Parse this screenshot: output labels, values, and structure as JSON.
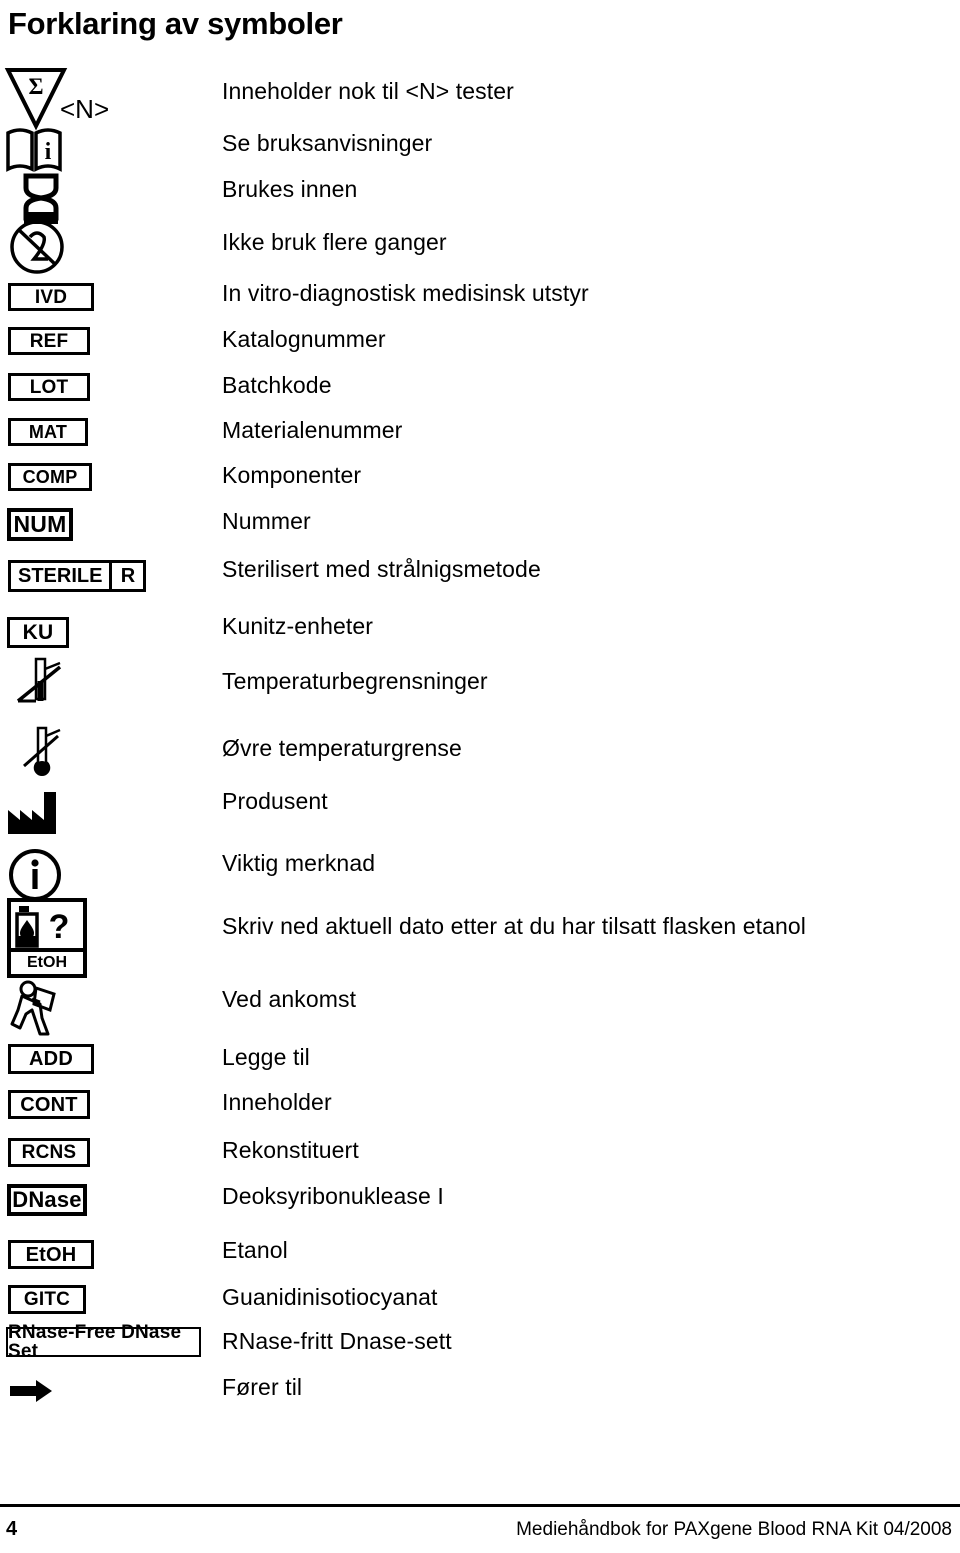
{
  "document": {
    "title": "Forklaring av symboler",
    "n_marker": "<N>"
  },
  "rows": [
    {
      "icon": "sum-triangle-n-icon",
      "label": "Inneholder nok til <N> tester"
    },
    {
      "icon": "consult-instructions-booklet-icon",
      "label": "Se bruksanvisninger"
    },
    {
      "icon": "use-by-hourglass-icon",
      "label": "Brukes innen"
    },
    {
      "icon": "do-not-reuse-icon",
      "label": "Ikke bruk flere ganger"
    },
    {
      "icon": "ivd-box-icon",
      "box_text": "IVD",
      "label": "In vitro-diagnostisk medisinsk utstyr"
    },
    {
      "icon": "ref-box-icon",
      "box_text": "REF",
      "label": "Katalognummer"
    },
    {
      "icon": "lot-box-icon",
      "box_text": "LOT",
      "label": "Batchkode"
    },
    {
      "icon": "mat-box-icon",
      "box_text": "MAT",
      "label": "Materialenummer"
    },
    {
      "icon": "comp-box-icon",
      "box_text": "COMP",
      "label": "Komponenter"
    },
    {
      "icon": "num-box-icon",
      "box_text": "NUM",
      "label": "Nummer"
    },
    {
      "icon": "sterile-r-box-icon",
      "box_text": "STERILE",
      "box_text2": "R",
      "label": "Sterilisert med strålnigsmetode"
    },
    {
      "icon": "ku-box-icon",
      "box_text": "KU",
      "label": "Kunitz-enheter"
    },
    {
      "icon": "temperature-limits-icon",
      "label": "Temperaturbegrensninger"
    },
    {
      "icon": "upper-temperature-limit-icon",
      "label": "Øvre temperaturgrense"
    },
    {
      "icon": "manufacturer-factory-icon",
      "label": "Produsent"
    },
    {
      "icon": "important-note-info-icon",
      "label": "Viktig merknad"
    },
    {
      "icon": "etoh-bottle-question-icon",
      "box_text": "EtOH",
      "label": "Skriv ned aktuell dato etter at du har tilsatt flasken etanol"
    },
    {
      "icon": "on-arrival-person-icon",
      "label": "Ved ankomst"
    },
    {
      "icon": "add-box-icon",
      "box_text": "ADD",
      "label": "Legge til"
    },
    {
      "icon": "cont-box-icon",
      "box_text": "CONT",
      "label": "Inneholder"
    },
    {
      "icon": "rcns-box-icon",
      "box_text": "RCNS",
      "label": "Rekonstituert"
    },
    {
      "icon": "dnase-box-icon",
      "box_text": "DNase",
      "label": "Deoksyribonuklease I"
    },
    {
      "icon": "etoh-box-icon",
      "box_text": "EtOH",
      "label": "Etanol"
    },
    {
      "icon": "gitc-box-icon",
      "box_text": "GITC",
      "label": "Guanidinisotiocyanat"
    },
    {
      "icon": "rnase-free-dnase-set-box-icon",
      "box_text": "RNase-Free DNase Set",
      "label": "RNase-fritt Dnase-sett"
    },
    {
      "icon": "leads-to-arrow-icon",
      "label": "Fører til"
    }
  ],
  "footer": {
    "page_number": "4",
    "text": "Mediehåndbok for PAXgene Blood RNA Kit   04/2008"
  },
  "colors": {
    "ink": "#000000",
    "background": "#ffffff"
  }
}
